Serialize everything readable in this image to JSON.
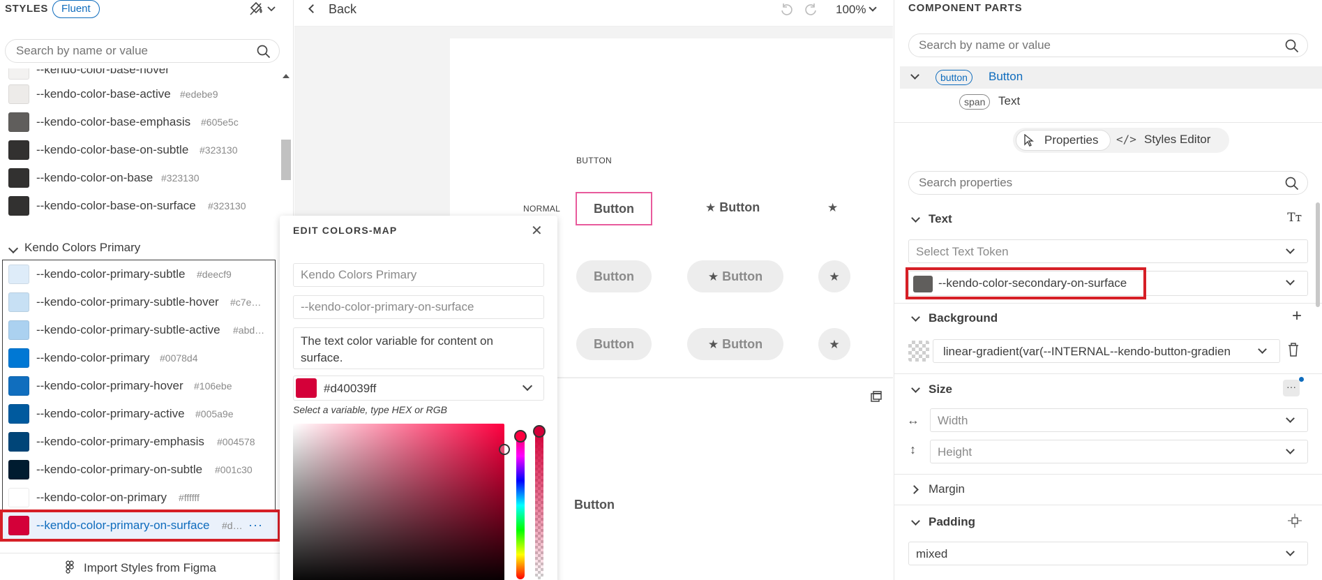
{
  "left": {
    "title": "STYLES",
    "theme_chip": "Fluent",
    "search_placeholder": "Search by name or value",
    "partial_item": "--kendo-color-base-hover",
    "items_top": [
      {
        "name": "--kendo-color-base-active",
        "hex": "#edebe9",
        "color": "#edebe9"
      },
      {
        "name": "--kendo-color-base-emphasis",
        "hex": "#605e5c",
        "color": "#605e5c"
      },
      {
        "name": "--kendo-color-base-on-subtle",
        "hex": "#323130",
        "color": "#323130"
      },
      {
        "name": "--kendo-color-on-base",
        "hex": "#323130",
        "color": "#323130"
      },
      {
        "name": "--kendo-color-base-on-surface",
        "hex": "#323130",
        "color": "#323130"
      }
    ],
    "group_label": "Kendo Colors Primary",
    "items_primary": [
      {
        "name": "--kendo-color-primary-subtle",
        "hex": "#deecf9",
        "color": "#deecf9"
      },
      {
        "name": "--kendo-color-primary-subtle-hover",
        "hex": "#c7e…",
        "color": "#c7e0f4"
      },
      {
        "name": "--kendo-color-primary-subtle-active",
        "hex": "#abd…",
        "color": "#abd1f0"
      },
      {
        "name": "--kendo-color-primary",
        "hex": "#0078d4",
        "color": "#0078d4"
      },
      {
        "name": "--kendo-color-primary-hover",
        "hex": "#106ebe",
        "color": "#106ebe"
      },
      {
        "name": "--kendo-color-primary-active",
        "hex": "#005a9e",
        "color": "#005a9e"
      },
      {
        "name": "--kendo-color-primary-emphasis",
        "hex": "#004578",
        "color": "#004578"
      },
      {
        "name": "--kendo-color-primary-on-subtle",
        "hex": "#001c30",
        "color": "#001c30"
      },
      {
        "name": "--kendo-color-on-primary",
        "hex": "#ffffff",
        "color": "#ffffff"
      },
      {
        "name": "--kendo-color-primary-on-surface",
        "hex": "#d…",
        "color": "#d40039"
      }
    ],
    "more_label": "···",
    "import_label": "Import Styles from Figma"
  },
  "center": {
    "back_label": "Back",
    "zoom": "100%",
    "col_label": "BUTTON",
    "row_label": "NORMAL",
    "button_text": "Button",
    "lower_button_text": "Button"
  },
  "popup": {
    "title": "EDIT COLORS-MAP",
    "close": "✕",
    "group_field": "Kendo Colors Primary",
    "name_field": "--kendo-color-primary-on-surface",
    "description": "The text color variable for content on surface.",
    "color_value": "#d40039ff",
    "hint": "Select a variable, type HEX or RGB"
  },
  "right": {
    "title": "COMPONENT PARTS",
    "search_placeholder": "Search by name or value",
    "tree": [
      {
        "tag": "button",
        "name": "Button"
      },
      {
        "tag": "span",
        "name": "Text"
      }
    ],
    "tab_properties": "Properties",
    "tab_styles_editor": "Styles Editor",
    "search_props_placeholder": "Search properties",
    "text_section": "Text",
    "text_token_placeholder": "Select Text Token",
    "color_token": "--kendo-color-secondary-on-surface",
    "background_section": "Background",
    "background_value": "linear-gradient(var(--INTERNAL--kendo-button-gradien",
    "size_section": "Size",
    "width_placeholder": "Width",
    "height_placeholder": "Height",
    "margin_section": "Margin",
    "padding_section": "Padding",
    "padding_value": "mixed"
  }
}
